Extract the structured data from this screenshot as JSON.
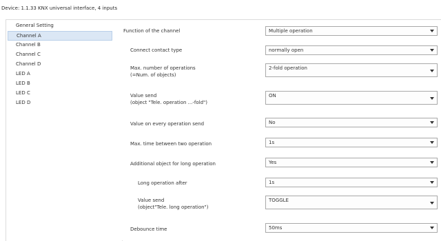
{
  "window": {
    "title": "Device: 1.1.33  KNX universal interface, 4 inputs"
  },
  "sidebar": {
    "items": [
      {
        "label": "General Setting",
        "selected": false
      },
      {
        "label": "Channel A",
        "selected": true
      },
      {
        "label": "Channel B",
        "selected": false
      },
      {
        "label": "Channel C",
        "selected": false
      },
      {
        "label": "Channel D",
        "selected": false
      },
      {
        "label": "LED A",
        "selected": false
      },
      {
        "label": "LED B",
        "selected": false
      },
      {
        "label": "LED C",
        "selected": false
      },
      {
        "label": "LED D",
        "selected": false
      }
    ]
  },
  "params": [
    {
      "label": "Function of the channel",
      "sub": "",
      "value": "Multiple operation"
    },
    {
      "label": "Connect contact type",
      "sub": "",
      "value": "normally open"
    },
    {
      "label": "Max. number of operations",
      "sub": "(=Num. of objects)",
      "value": "2-fold operation"
    },
    {
      "label": "Value send",
      "sub": "(object \"Tele. operation ...-fold\")",
      "value": "ON"
    },
    {
      "label": "Value on every operation send",
      "sub": "",
      "value": "No"
    },
    {
      "label": "Max. time between two operation",
      "sub": "",
      "value": "1s"
    },
    {
      "label": "Additional object for long operation",
      "sub": "",
      "value": "Yes"
    },
    {
      "label": "Long operation after",
      "sub": "",
      "value": "1s"
    },
    {
      "label": "Value send",
      "sub": "(object\"Tele. long operation\")",
      "value": "TOGGLE"
    },
    {
      "label": "Debounce time",
      "sub": "",
      "value": "50ms"
    }
  ],
  "colors": {
    "selection": "#dbe7f5",
    "border": "#a8a8a8"
  }
}
